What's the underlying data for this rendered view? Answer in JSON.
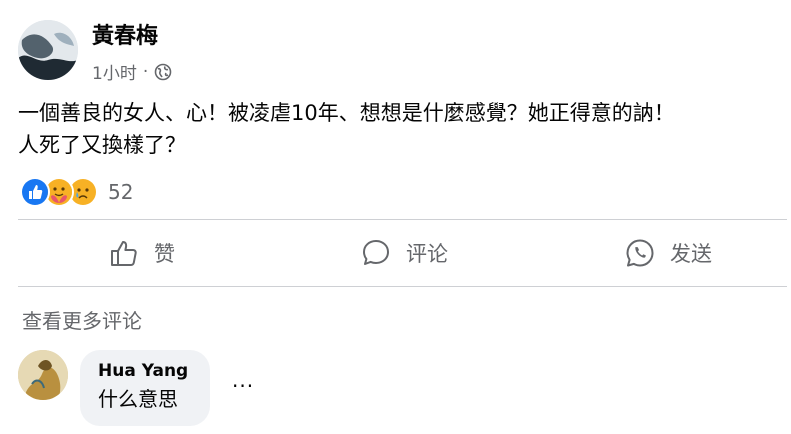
{
  "post": {
    "author_name": "黃春梅",
    "time": "1小时",
    "separator": "·",
    "privacy_icon": "globe-icon",
    "body_lines": [
      "一個善良的女人、心！被凌虐10年、想想是什麼感覺？她正得意的訥！",
      "人死了又換樣了？"
    ],
    "reaction_icons": [
      "like-icon",
      "care-icon",
      "sad-icon"
    ],
    "reaction_count": "52"
  },
  "actions": {
    "like_label": "赞",
    "comment_label": "评论",
    "send_label": "发送"
  },
  "comments": {
    "view_more_label": "查看更多评论",
    "items": [
      {
        "author": "Hua Yang",
        "text": "什么意思",
        "menu_label": "···"
      }
    ]
  },
  "colors": {
    "text_primary": "#050505",
    "text_secondary": "#65676b",
    "divider": "#ced0d4",
    "bubble_bg": "#f0f2f5",
    "like_blue": "#1877f2",
    "reaction_yellow": "#f7b125"
  }
}
